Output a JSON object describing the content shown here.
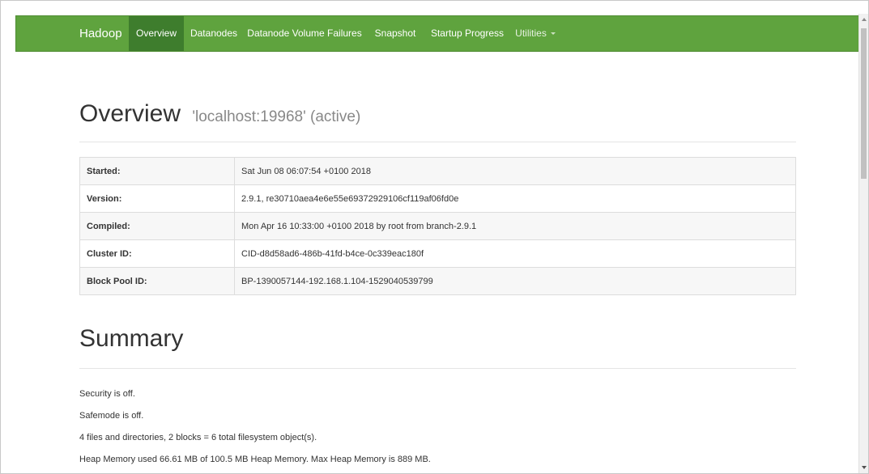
{
  "navbar": {
    "brand": "Hadoop",
    "items": [
      {
        "label": "Overview",
        "active": true
      },
      {
        "label": "Datanodes"
      },
      {
        "label": "Datanode Volume Failures"
      },
      {
        "label": "Snapshot"
      },
      {
        "label": "Startup Progress"
      },
      {
        "label": "Utilities",
        "dropdown": true
      }
    ],
    "color": "#5fa33e",
    "active_color": "#3e7d2d"
  },
  "overview": {
    "title": "Overview",
    "subtitle": "'localhost:19968' (active)",
    "rows": [
      {
        "key": "Started:",
        "value": "Sat Jun 08 06:07:54 +0100 2018"
      },
      {
        "key": "Version:",
        "value": "2.9.1, re30710aea4e6e55e69372929106cf119af06fd0e"
      },
      {
        "key": "Compiled:",
        "value": "Mon Apr 16 10:33:00 +0100 2018 by root from branch-2.9.1"
      },
      {
        "key": "Cluster ID:",
        "value": "CID-d8d58ad6-486b-41fd-b4ce-0c339eac180f"
      },
      {
        "key": "Block Pool ID:",
        "value": "BP-1390057144-192.168.1.104-1529040539799"
      }
    ]
  },
  "summary": {
    "title": "Summary",
    "lines": [
      "Security is off.",
      "Safemode is off.",
      "4 files and directories, 2 blocks = 6 total filesystem object(s).",
      "Heap Memory used 66.61 MB of 100.5 MB Heap Memory. Max Heap Memory is 889 MB."
    ]
  }
}
